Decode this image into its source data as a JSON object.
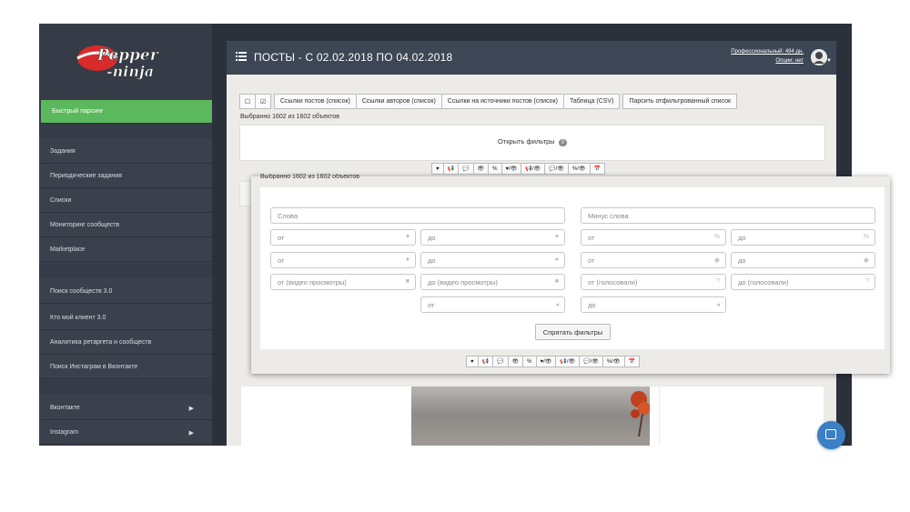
{
  "app": {
    "brand": "Pepper ninja",
    "title": "ПОСТЫ - С 02.02.2018 ПО 04.02.2018",
    "account": {
      "plan": "Профессиональный: 494 дн.",
      "options": "Опции: нет"
    }
  },
  "sidebar": {
    "quick": "Быстрый парсинг",
    "group1": [
      "Задания",
      "Периодические задания",
      "Списки",
      "Мониторинг сообществ",
      "Marketplace"
    ],
    "group2": [
      "Поиск сообществ 3.0",
      "Кто мой клиент 3.0",
      "Аналитика ретаргета и сообществ",
      "Поиск Инстаграм в Вконтакте"
    ],
    "group3": [
      "Вконтакте",
      "Instagram"
    ]
  },
  "toolbar": {
    "checkbox_icon": "square-icon",
    "check_icon": "check-square-icon",
    "buttons": [
      "Ссылки постов (список)",
      "Ссылки авторов (список)",
      "Ссылки на источники постов (список)",
      "Таблица (CSV)",
      "Парсить отфильтрованный список"
    ]
  },
  "selection": "Выбранно 1602 из 1602 объектов",
  "filters": {
    "open_label": "Открыть фильтры",
    "open_count": "0",
    "hide_label": "Спрятать фильтры",
    "words_placeholder": "Слова",
    "minus_words_placeholder": "Минус слова",
    "from": "от",
    "to": "до",
    "from_video": "от (видео просмотры)",
    "to_video": "до (видео просмотры)",
    "from_votes": "от (голосовали)",
    "to_votes": "до (голосовали)"
  },
  "sort_icons": [
    "♥",
    "📢",
    "💬",
    "👁",
    "%",
    "♥/👁",
    "📢/👁",
    "💬/👁",
    "%/👁",
    "📅"
  ],
  "colors": {
    "accent": "#5cb85c",
    "topbar": "#3c4654",
    "sidebar": "#353c47",
    "chat": "#3b7fc4"
  }
}
